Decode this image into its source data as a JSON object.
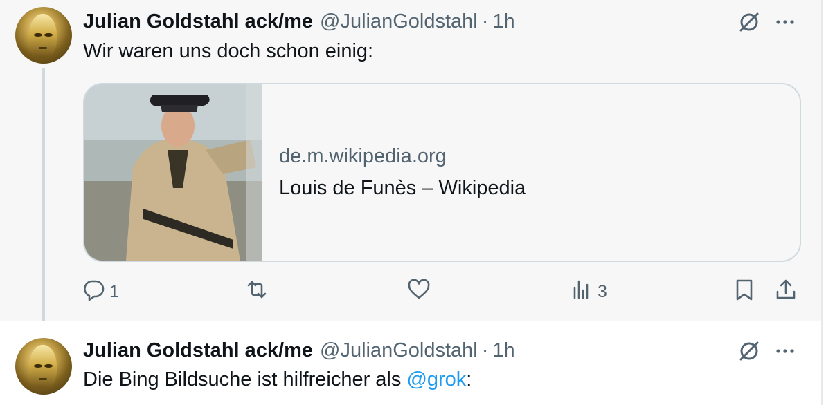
{
  "tweets": [
    {
      "author_name": "Julian Goldstahl ack/me",
      "handle": "@JulianGoldstahl",
      "separator": "·",
      "time": "1h",
      "text": "Wir waren uns doch schon einig:",
      "card": {
        "domain": "de.m.wikipedia.org",
        "title": "Louis de Funès – Wikipedia"
      },
      "actions": {
        "reply_count": "1",
        "retweet_count": "",
        "like_count": "",
        "views_count": "3"
      }
    },
    {
      "author_name": "Julian Goldstahl ack/me",
      "handle": "@JulianGoldstahl",
      "separator": "·",
      "time": "1h",
      "text_before": "Die Bing Bildsuche ist hilfreicher als ",
      "mention": "@grok",
      "text_after": ":"
    }
  ],
  "icons": {
    "grok": "grok-icon",
    "more": "more-icon",
    "reply": "reply-icon",
    "retweet": "retweet-icon",
    "like": "like-icon",
    "views": "views-icon",
    "bookmark": "bookmark-icon",
    "share": "share-icon"
  },
  "colors": {
    "text_primary": "#0f1419",
    "text_secondary": "#536471",
    "mention": "#1d9bf0",
    "border": "#cfd9de"
  }
}
